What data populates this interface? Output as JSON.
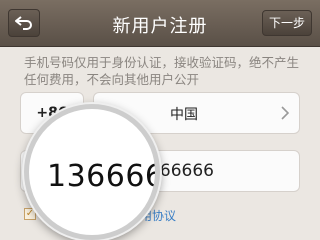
{
  "header": {
    "title": "新用户注册",
    "next_label": "下一步",
    "back_icon": "back-arrow-icon"
  },
  "notice": "手机号码仅用于身份认证，接收验证码，绝不产生任何费用，不会向其他用户公开",
  "country": {
    "code": "+86",
    "name": "中国"
  },
  "phone": {
    "value": "13666666666",
    "magnified_value": "136666"
  },
  "agreement": {
    "checked": true,
    "prefix": "阅读",
    "link": "使用协议"
  },
  "colors": {
    "nav_bar": "#6a5f55",
    "background": "#ebe7e2",
    "link": "#3a7fc6",
    "note_text": "#8a8580"
  }
}
